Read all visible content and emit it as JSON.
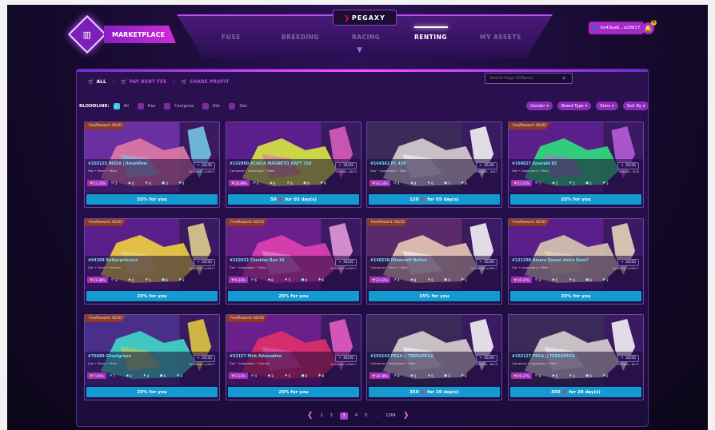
{
  "header": {
    "logo_label": "MARKETPLACE",
    "brand": "PEGAXY",
    "nav": [
      "FUSE",
      "BREEDING",
      "RACING",
      "RENTING",
      "MY ASSETS"
    ],
    "active_nav": "RENTING",
    "wallet": "0x43ea6...a29817",
    "notifications": "5"
  },
  "tabs": [
    "ALL",
    "PAY RENT FEE",
    "SHARE PROFIT"
  ],
  "search": {
    "placeholder": "Search Pega ID/Name"
  },
  "bloodline": {
    "label": "BLOODLINE:",
    "options": [
      "All",
      "Hoz",
      "Campona",
      "Klin",
      "Zan"
    ],
    "checked": "All"
  },
  "filters": [
    "Gender",
    "Breed Type",
    "Stars",
    "Sort By"
  ],
  "colors": {
    "accent": "#b13bd8",
    "button": "#139ad0",
    "tag": "#8b3a28"
  },
  "cards": [
    {
      "tag": "Fee/Reward: 60/35",
      "name": "#103125 NISSA | Amanflow",
      "meta": "Hoz • Pacer • Male",
      "gen": "35/35",
      "owner": "0x43ea6...a29817",
      "win": "13.33%",
      "stats": [
        "3",
        "4",
        "4",
        "3",
        "4"
      ],
      "action": "55% for you"
    },
    {
      "tag": "",
      "name": "#102980 ACACIA MAGNETO_RAFT 158",
      "meta": "Campona • Legendary • Male",
      "gen": "35/35",
      "owner": "0x5e0a...8b70",
      "win": "28.89%",
      "stats": [
        "4",
        "8",
        "8",
        "8",
        "9"
      ],
      "action": "50 🩸 for 03 day(s)"
    },
    {
      "tag": "",
      "name": "#164362 PC 420",
      "meta": "Zan • Legendary • Male",
      "gen": "35/35",
      "owner": "0x4d35...3a47",
      "win": "43.24%",
      "stats": [
        "4",
        "8",
        "6",
        "7",
        "8"
      ],
      "action": "150 🩸 for 05 day(s)"
    },
    {
      "tag": "Fee/Reward: 60/35",
      "name": "#160827 Emerald 82",
      "meta": "Zan • Legendary • Male",
      "gen": "35/35",
      "owner": "0x8b84...2f16",
      "win": "25.67%",
      "stats": [
        "7",
        "5",
        "5",
        "2",
        "3"
      ],
      "action": "25% for you"
    },
    {
      "tag": "Fee/Reward: 60/35",
      "name": "#94308 Butterprincess",
      "meta": "Zan • Pacer • Female",
      "gen": "35/35",
      "owner": "0x43ea6...a29817",
      "win": "21.88%",
      "stats": [
        "3",
        "4",
        "5",
        "6",
        "3"
      ],
      "action": "25% for you"
    },
    {
      "tag": "Fee/Reward: 60/35",
      "name": "#162032 Cheddar Bun 92",
      "meta": "Zan • Legendary • Male",
      "gen": "35/35",
      "owner": "0x43ea6...a29817",
      "win": "6.34%",
      "stats": [
        "6",
        "8",
        "5",
        "4",
        "6"
      ],
      "action": "25% for you"
    },
    {
      "tag": "Fee/Reward: 60/35",
      "name": "#148238 Minecraft Nation",
      "meta": "Campona • Pacer • Male",
      "gen": "35/35",
      "owner": "0x43ea6...a29817",
      "win": "23.62%",
      "stats": [
        "4",
        "8",
        "6",
        "4",
        "5"
      ],
      "action": "25% for you"
    },
    {
      "tag": "Fee/Reward: 60/35",
      "name": "#121298 Amara Queen Astro Bowl?",
      "meta": "Zan • Legendary • Male",
      "gen": "35/35",
      "owner": "0x43ea6...a29817",
      "win": "36.15%",
      "stats": [
        "4",
        "5",
        "6",
        "8",
        "3"
      ],
      "action": "25% for you"
    },
    {
      "tag": "Fee/Reward: 60/35",
      "name": "#76689 Ghostgreen",
      "meta": "Zan • Pacer • Male",
      "gen": "35/35",
      "owner": "0x43ea6...a29817",
      "win": "7.04%",
      "stats": [
        "7",
        "3",
        "4",
        "6",
        "3"
      ],
      "action": "25% for you"
    },
    {
      "tag": "Fee/Reward: 60/35",
      "name": "#32157 Pink Adrenaline",
      "meta": "Zan • Legendary • Female",
      "gen": "35/35",
      "owner": "0x43ea6...a29817",
      "win": "3.12%",
      "stats": [
        "4",
        "3",
        "5",
        "6",
        "8"
      ],
      "action": "25% for you"
    },
    {
      "tag": "",
      "name": "#102143 PEGA || TERRAPEGA",
      "meta": "Campona • Legendary • Male",
      "gen": "35/35",
      "owner": "0x5e0a...8b70",
      "win": "34.38%",
      "stats": [
        "8",
        "5",
        "6",
        "5",
        "6"
      ],
      "action": "350 🩸 for 20 day(s)"
    },
    {
      "tag": "",
      "name": "#102127 PEGA || TERRAPEGA",
      "meta": "Campona • Legendary • Male",
      "gen": "35/35",
      "owner": "0x5e0a...8b70",
      "win": "20.27%",
      "stats": [
        "8",
        "6",
        "4",
        "6",
        "6"
      ],
      "action": "350 🩸 for 20 day(s)"
    }
  ],
  "pagination": {
    "pages": [
      "1",
      "2",
      "3",
      "4",
      "5",
      "...",
      "1264"
    ],
    "current": "3"
  }
}
